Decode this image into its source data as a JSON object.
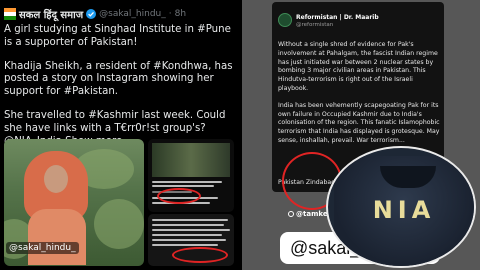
{
  "tweet": {
    "display_name": "सकल हिंदू समाज",
    "handle": "@sakal_hindu_",
    "time": "8h",
    "paragraphs": [
      "A girl studying at Singhad Institute in #Pune is a supporter of Pakistan!",
      "Khadija Sheikh, a resident of #Kondhwa, has posted a story on Instagram showing her support for #Pakistan.",
      "She travelled to #Kashmir last week. Could she have links with a T€rr0r!st group's? @NIA_India Show more"
    ],
    "image_watermark": "@sakal_hindu_"
  },
  "instagram": {
    "account_name": "Reformistan | Dr. Maarib",
    "account_handle": "@reformistan",
    "post_paragraphs": [
      "Without a single shred of evidence for Pak's involvement at Pahalgam, the fascist Indian regime has just initiated war between 2 nuclear states by bombing 3 major civilian areas in Pakistan. This Hindutva-terrorism is right out of the Israeli playbook.",
      "India has been vehemently scapegoating Pak for its own failure in Occupied Kashmir due to India's colonisation of the region. This fanatic Islamophobic terrorism that India has displayed is grotesque. May sense, inshallah, prevail. War terrorism..."
    ],
    "post_tail": "Pakistan Zindabad",
    "story_user": "@tamkenat",
    "sticker_handle": "@sakal_h"
  },
  "nia_label": "NIA",
  "colors": {
    "annotation_ring": "#e02424",
    "tweet_bg": "#000000",
    "panel_bg": "#575757"
  }
}
